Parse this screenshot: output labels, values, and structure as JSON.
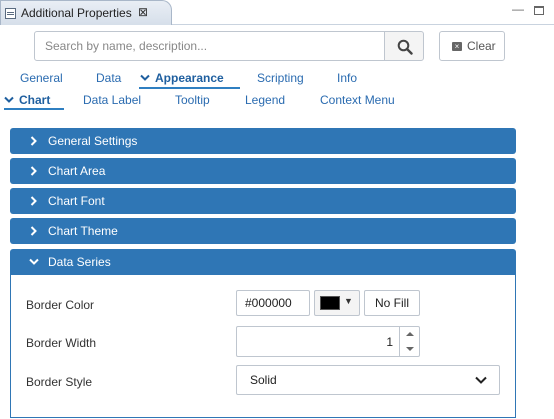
{
  "window": {
    "tab_title": "Additional Properties",
    "close_glyph": "⊠",
    "minimize_glyph": "▭"
  },
  "search": {
    "placeholder": "Search by name, description...",
    "value": "",
    "clear_label": "Clear"
  },
  "tabs_primary": [
    {
      "label": "General"
    },
    {
      "label": "Data"
    },
    {
      "label": "Appearance",
      "active": true
    },
    {
      "label": "Scripting"
    },
    {
      "label": "Info"
    }
  ],
  "tabs_secondary": [
    {
      "label": "Chart",
      "active": true
    },
    {
      "label": "Data Label"
    },
    {
      "label": "Tooltip"
    },
    {
      "label": "Legend"
    },
    {
      "label": "Context Menu"
    }
  ],
  "sections": [
    {
      "label": "General Settings",
      "expanded": false
    },
    {
      "label": "Chart Area",
      "expanded": false
    },
    {
      "label": "Chart Font",
      "expanded": false
    },
    {
      "label": "Chart Theme",
      "expanded": false
    },
    {
      "label": "Data Series",
      "expanded": true
    }
  ],
  "data_series": {
    "border_color": {
      "label": "Border Color",
      "value": "#000000",
      "no_fill_label": "No Fill"
    },
    "border_width": {
      "label": "Border Width",
      "value": "1"
    },
    "border_style": {
      "label": "Border Style",
      "value": "Solid"
    }
  },
  "colors": {
    "accent": "#2f76b5",
    "link": "#2a6bb0",
    "swatch": "#000000"
  }
}
